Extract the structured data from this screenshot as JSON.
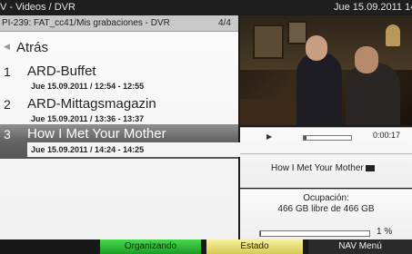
{
  "header": {
    "left": "V - Videos / DVR",
    "right": "Jue 15.09.2011 14:3"
  },
  "list": {
    "path": "PI-239: FAT_cc41/Mis grabaciones - DVR",
    "page": "4/4",
    "back_label": "Atrás",
    "items": [
      {
        "number": "1",
        "title": "ARD-Buffet",
        "datetime": "Jue 15.09.2011 / 12:54 - 12:55"
      },
      {
        "number": "2",
        "title": "ARD-Mittagsmagazin",
        "datetime": "Jue 15.09.2011 / 13:36 - 13:37"
      },
      {
        "number": "3",
        "title": "How I Met Your Mother",
        "datetime": "Jue 15.09.2011 / 14:24 - 14:25",
        "selected": true
      }
    ]
  },
  "player": {
    "progress_percent": 5,
    "time": "0:00:17",
    "now_playing": "How I Met Your Mother"
  },
  "storage": {
    "label": "Ocupación:",
    "value": "466 GB libre de 466 GB",
    "percent": "1 %",
    "percent_value": 1
  },
  "footer": {
    "green": "Organizando",
    "yellow": "Estado",
    "nav": "NAV Menú"
  }
}
